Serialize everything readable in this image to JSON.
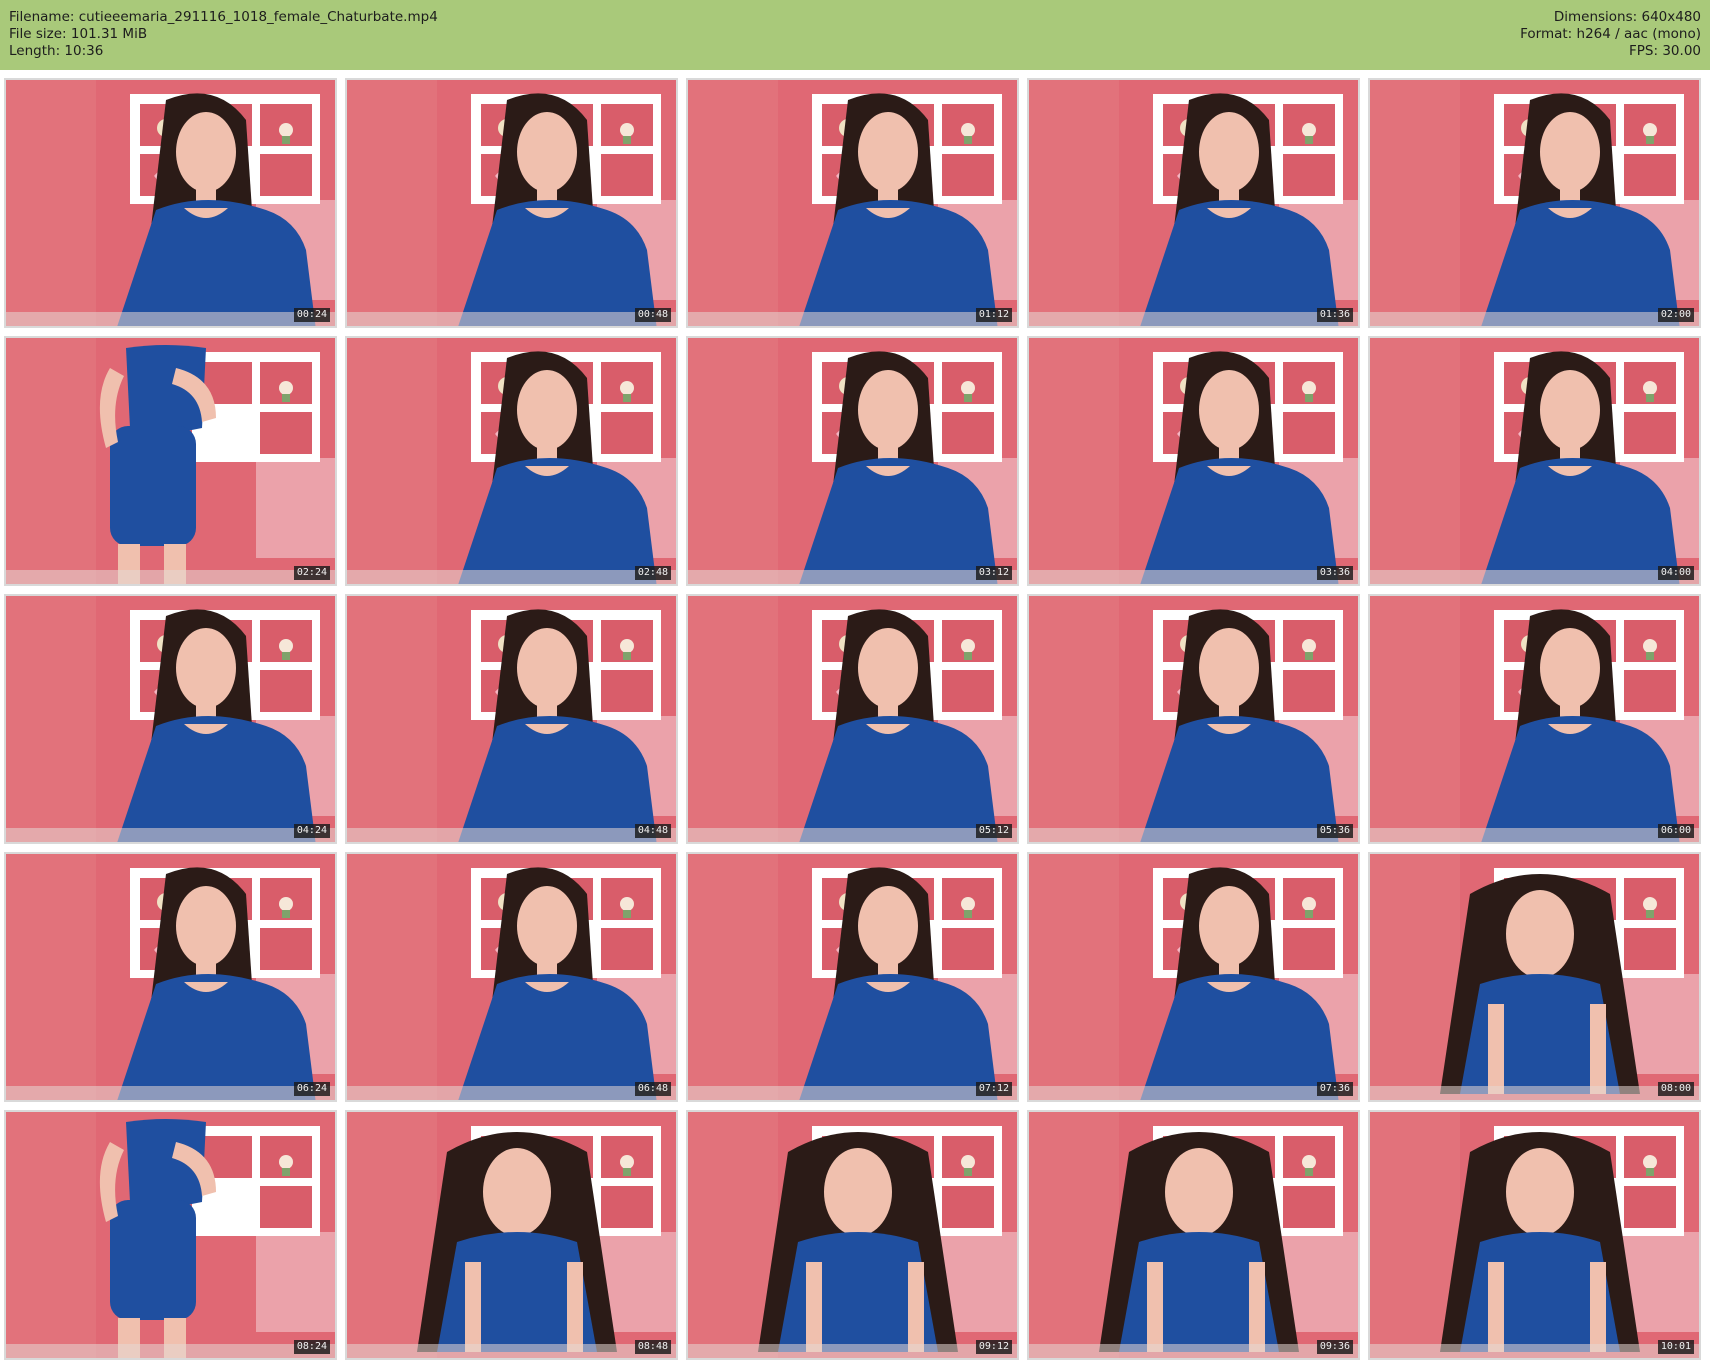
{
  "header": {
    "filename": "Filename: cutieeemaria_291116_1018_female_Chaturbate.mp4",
    "filesize": "File size: 101.31 MiB",
    "length": "Length: 10:36",
    "dimensions": "Dimensions: 640x480",
    "format": "Format: h264 / aac (mono)",
    "fps": "FPS: 30.00"
  },
  "colors": {
    "header_bg": "#a9c97a",
    "wall": "#e06874",
    "dress": "#1f4fa0",
    "hair": "#2b1b17",
    "skin": "#f0c0ae"
  },
  "thumbnails": [
    {
      "time": "00:24",
      "pose": "sit"
    },
    {
      "time": "00:48",
      "pose": "sit"
    },
    {
      "time": "01:12",
      "pose": "sit"
    },
    {
      "time": "01:36",
      "pose": "sit"
    },
    {
      "time": "02:00",
      "pose": "sit"
    },
    {
      "time": "02:24",
      "pose": "stand"
    },
    {
      "time": "02:48",
      "pose": "sit"
    },
    {
      "time": "03:12",
      "pose": "sit"
    },
    {
      "time": "03:36",
      "pose": "sit"
    },
    {
      "time": "04:00",
      "pose": "sit"
    },
    {
      "time": "04:24",
      "pose": "sit"
    },
    {
      "time": "04:48",
      "pose": "sit"
    },
    {
      "time": "05:12",
      "pose": "sit"
    },
    {
      "time": "05:36",
      "pose": "sit"
    },
    {
      "time": "06:00",
      "pose": "sit"
    },
    {
      "time": "06:24",
      "pose": "sit"
    },
    {
      "time": "06:48",
      "pose": "sit"
    },
    {
      "time": "07:12",
      "pose": "sit"
    },
    {
      "time": "07:36",
      "pose": "sit"
    },
    {
      "time": "08:00",
      "pose": "lean"
    },
    {
      "time": "08:24",
      "pose": "stand"
    },
    {
      "time": "08:48",
      "pose": "lean"
    },
    {
      "time": "09:12",
      "pose": "lean"
    },
    {
      "time": "09:36",
      "pose": "lean"
    },
    {
      "time": "10:01",
      "pose": "lean"
    }
  ]
}
